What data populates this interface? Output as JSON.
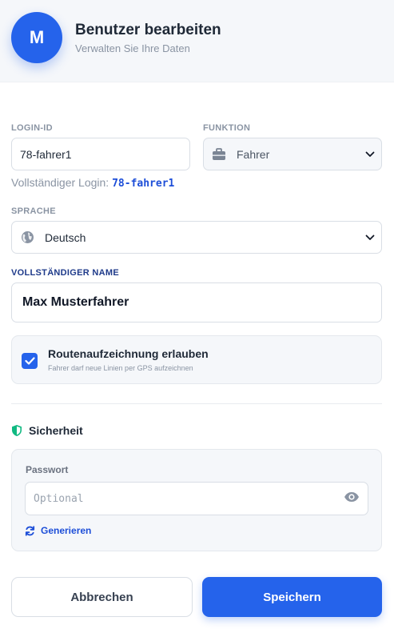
{
  "header": {
    "avatar_initial": "M",
    "title": "Benutzer bearbeiten",
    "subtitle": "Verwalten Sie Ihre Daten"
  },
  "form": {
    "login_id": {
      "label": "LOGIN-ID",
      "value": "78-fahrer1",
      "hint_prefix": "Vollständiger Login:",
      "hint_value": "78-fahrer1"
    },
    "funktion": {
      "label": "FUNKTION",
      "selected": "Fahrer",
      "icon": "briefcase-icon"
    },
    "sprache": {
      "label": "SPRACHE",
      "selected": "Deutsch",
      "icon": "globe-icon"
    },
    "full_name": {
      "label": "VOLLSTÄNDIGER NAME",
      "value": "Max Musterfahrer"
    },
    "route_recording": {
      "checked": true,
      "title": "Routenaufzeichnung erlauben",
      "description": "Fahrer darf neue Linien per GPS aufzeichnen"
    }
  },
  "security": {
    "title": "Sicherheit",
    "icon": "shield-icon",
    "password": {
      "label": "Passwort",
      "placeholder": "Optional",
      "icon": "eye-icon"
    },
    "generate_label": "Generieren"
  },
  "actions": {
    "cancel_label": "Abbrechen",
    "save_label": "Speichern"
  },
  "colors": {
    "primary": "#2563eb",
    "link": "#1d4ed8",
    "muted": "#8a94a3",
    "success": "#10b981"
  }
}
